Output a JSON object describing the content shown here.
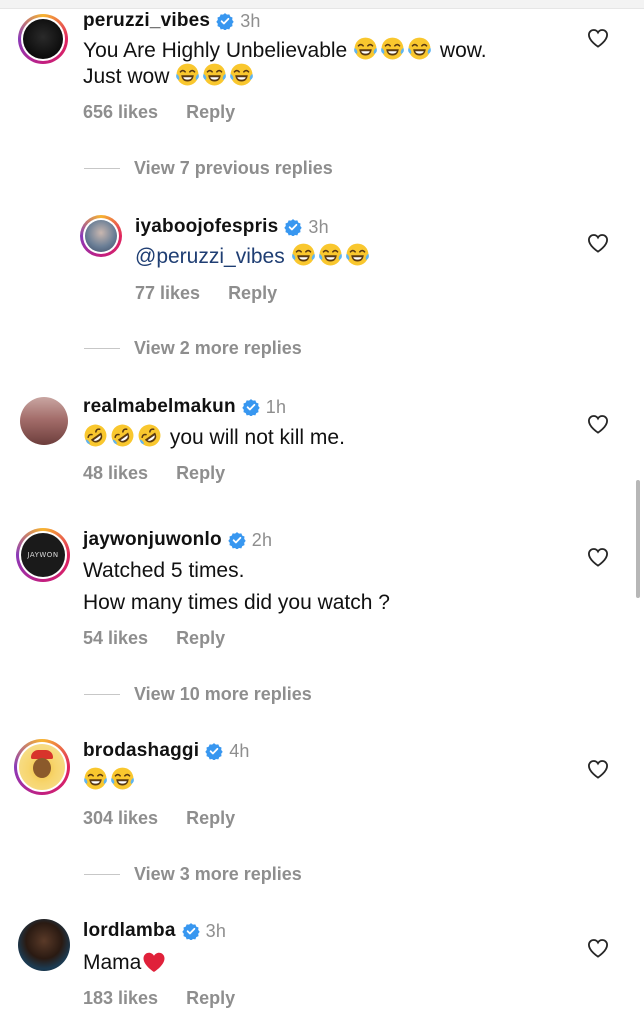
{
  "comments": [
    {
      "username": "peruzzi_vibes",
      "time": "3h",
      "text_line1_pre": "You Are Highly Unbelievable",
      "text_line1_post": "wow.",
      "text_line2": "Just wow",
      "likes": "656 likes",
      "reply": "Reply",
      "view_replies": "View 7 previous replies"
    },
    {
      "username": "iyaboojofespris",
      "time": "3h",
      "mention": "@peruzzi_vibes",
      "likes": "77 likes",
      "reply": "Reply",
      "view_replies": "View 2 more replies"
    },
    {
      "username": "realmabelmakun",
      "time": "1h",
      "text": "you will not kill me.",
      "likes": "48 likes",
      "reply": "Reply"
    },
    {
      "username": "jaywonjuwonlo",
      "time": "2h",
      "text_line1": "Watched 5 times.",
      "text_line2": "How many times did you watch ?",
      "avatar_text": "JAYWON",
      "likes": "54 likes",
      "reply": "Reply",
      "view_replies": "View 10 more replies"
    },
    {
      "username": "brodashaggi",
      "time": "4h",
      "likes": "304 likes",
      "reply": "Reply",
      "view_replies": "View 3 more replies"
    },
    {
      "username": "lordlamba",
      "time": "3h",
      "text": "Mama",
      "likes": "183 likes",
      "reply": "Reply"
    }
  ],
  "colors": {
    "verified": "#3897f0",
    "meta_gray": "#8e8e8e",
    "mention": "#1f3e73",
    "heart_red": "#e0213a"
  },
  "icons": {
    "like": "heart-outline-icon",
    "verified": "verified-badge-icon",
    "emoji_joy": "face-with-tears-of-joy-icon",
    "emoji_rofl": "rolling-on-floor-laughing-icon",
    "red_heart": "red-heart-icon"
  }
}
